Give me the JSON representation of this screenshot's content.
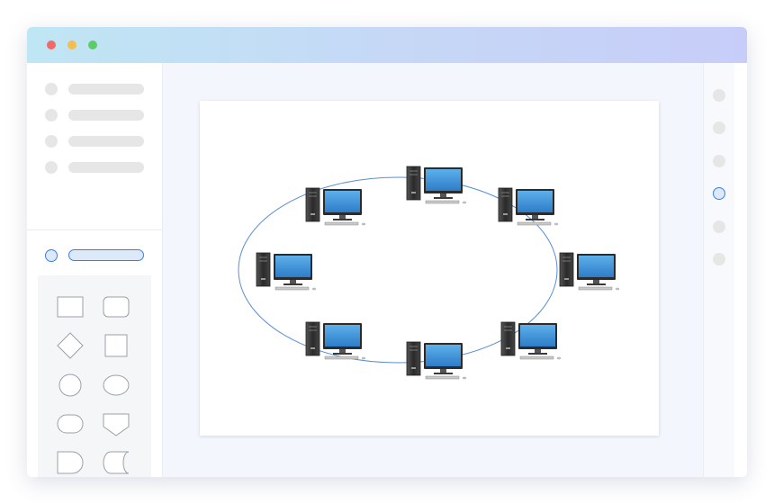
{
  "window": {
    "traffic_lights": [
      {
        "name": "close",
        "color": "#ef6b6b"
      },
      {
        "name": "minimize",
        "color": "#f5bd4f"
      },
      {
        "name": "maximize",
        "color": "#5ccc6a"
      }
    ]
  },
  "colors": {
    "accent": "#3d7fe0",
    "monitor_screen": "#3d8fd8",
    "network_ring": "#5a8fd6"
  },
  "sidebar": {
    "placeholder_rows": 4,
    "active_item": "selected"
  },
  "shapes": [
    "rectangle",
    "rounded-rectangle",
    "diamond",
    "square",
    "circle",
    "ellipse",
    "stadium",
    "pentagon-arrow",
    "delay",
    "stored-data"
  ],
  "diagram": {
    "type": "ring-network",
    "nodes": [
      "computer-1",
      "computer-2",
      "computer-3",
      "computer-4",
      "computer-5",
      "computer-6",
      "computer-7",
      "computer-8"
    ]
  },
  "right_toolbar": {
    "items": 6,
    "active_index": 3
  }
}
